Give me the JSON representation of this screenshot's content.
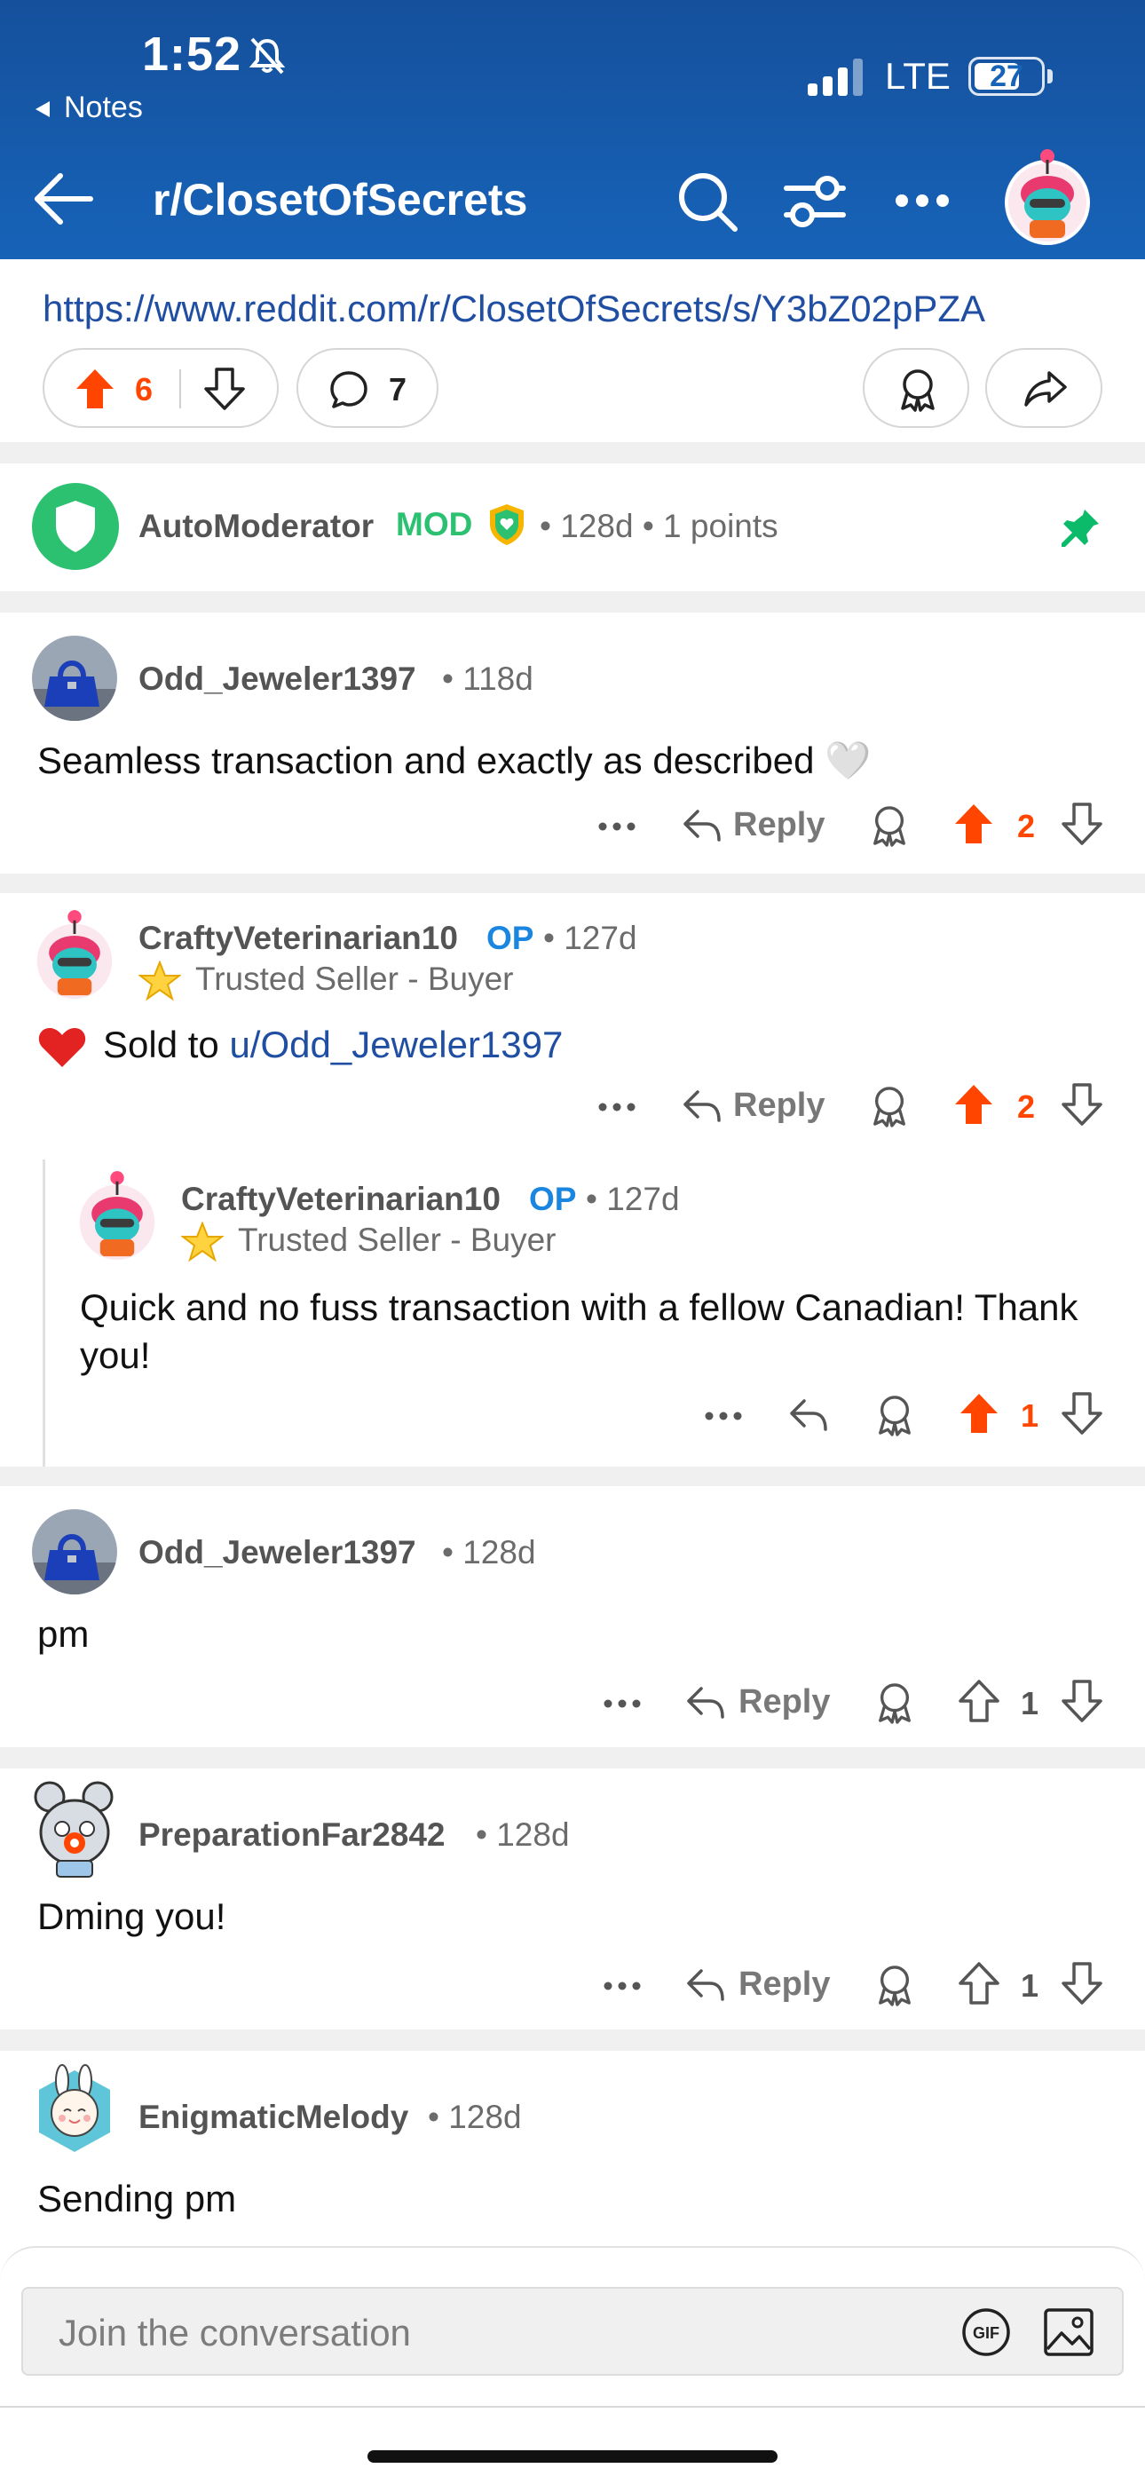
{
  "status_bar": {
    "time": "1:52",
    "back_app": "Notes",
    "network": "LTE",
    "battery": "27"
  },
  "header": {
    "title": "r/ClosetOfSecrets"
  },
  "post_bar": {
    "url": "https://www.reddit.com/r/ClosetOfSecrets/s/Y3bZ02pPZA",
    "upvotes": "6",
    "comments": "7"
  },
  "pinned": {
    "username": "AutoModerator",
    "badge": "MOD",
    "meta": "• 128d • 1 points"
  },
  "comments": [
    {
      "username": "Odd_Jeweler1397",
      "meta": "• 118d",
      "text": "Seamless transaction and exactly as described 🤍",
      "reply_label": "Reply",
      "votes": "2"
    },
    {
      "username": "CraftyVeterinarian10",
      "badge": "OP",
      "meta": "• 127d",
      "flair": "Trusted Seller - Buyer",
      "text_prefix": "Sold to ",
      "text_link": "u/Odd_Jeweler1397",
      "reply_label": "Reply",
      "votes": "2"
    },
    {
      "username": "CraftyVeterinarian10",
      "badge": "OP",
      "meta": "• 127d",
      "flair": "Trusted Seller - Buyer",
      "text": "Quick and no fuss transaction with a fellow Canadian! Thank you!",
      "votes": "1"
    },
    {
      "username": "Odd_Jeweler1397",
      "meta": "• 128d",
      "text": "pm",
      "reply_label": "Reply",
      "votes": "1"
    },
    {
      "username": "PreparationFar2842",
      "meta": "• 128d",
      "text": "Dming you!",
      "reply_label": "Reply",
      "votes": "1"
    },
    {
      "username": "EnigmaticMelody",
      "meta": "• 128d",
      "text": "Sending pm"
    }
  ],
  "composer": {
    "placeholder": "Join the conversation",
    "gif_label": "GIF"
  },
  "colors": {
    "header_blue": "#1763b8",
    "upvote_orange": "#ff4500",
    "mod_green": "#2cc171",
    "op_blue": "#1a86e0",
    "link_blue": "#1f4ea3"
  }
}
